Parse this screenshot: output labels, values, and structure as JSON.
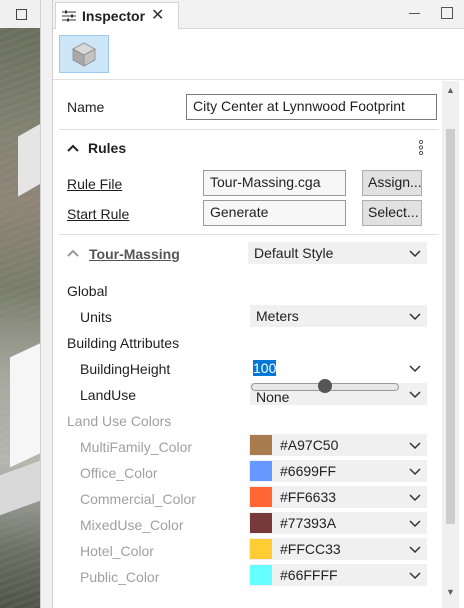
{
  "inspector": {
    "title": "Inspector",
    "name_label": "Name",
    "name_value": "City Center at Lynnwood Footprint",
    "rules": {
      "title": "Rules",
      "rule_file_label": "Rule File",
      "rule_file_value": "Tour-Massing.cga",
      "assign_label": "Assign...",
      "start_rule_label": "Start Rule",
      "start_rule_value": "Generate",
      "select_label": "Select..."
    },
    "attributes": {
      "rule_name": "Tour-Massing",
      "style_value": "Default Style",
      "global_label": "Global",
      "units_label": "Units",
      "units_value": "Meters",
      "building_attrs_label": "Building Attributes",
      "building_height_label": "BuildingHeight",
      "building_height_value": "100",
      "building_height_slider_fraction": 0.5,
      "land_use_label": "LandUse",
      "land_use_value": "None",
      "land_use_colors_label": "Land Use Colors",
      "colors": [
        {
          "label": "MultiFamily_Color",
          "value": "#A97C50",
          "color": "#A97C50"
        },
        {
          "label": "Office_Color",
          "value": "#6699FF",
          "color": "#6699FF"
        },
        {
          "label": "Commercial_Color",
          "value": "#FF6633",
          "color": "#FF6633"
        },
        {
          "label": "MixedUse_Color",
          "value": "#77393A",
          "color": "#77393A"
        },
        {
          "label": "Hotel_Color",
          "value": "#FFCC33",
          "color": "#FFCC33"
        },
        {
          "label": "Public_Color",
          "value": "#66FFFF",
          "color": "#66FFFF"
        }
      ]
    }
  },
  "icons": {
    "tab": "sliders-icon",
    "close": "close-icon",
    "model": "cube-icon",
    "menu": "more-vertical-icon",
    "collapse": "chevron-up-icon",
    "dropdown": "chevron-down-icon"
  },
  "colors": {
    "selection": "#0078d7",
    "model_button_bg": "#cde6f7"
  }
}
